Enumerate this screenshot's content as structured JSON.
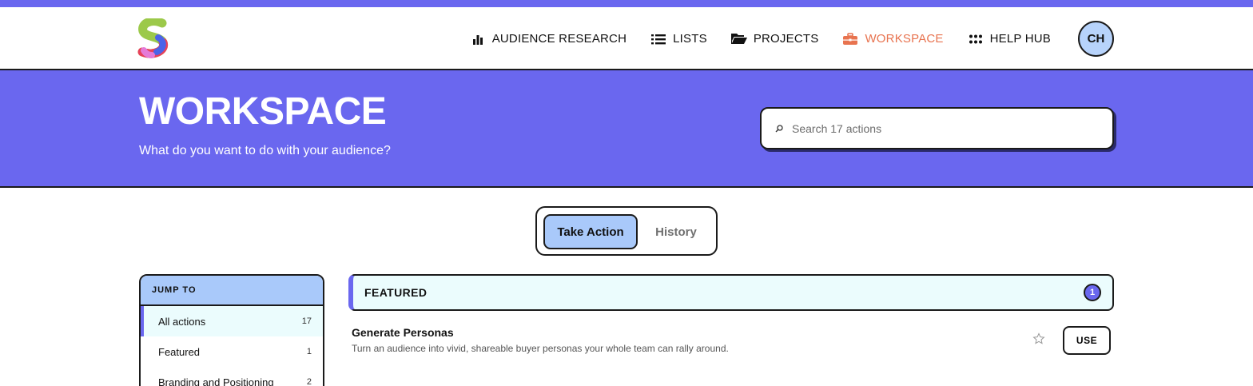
{
  "nav": {
    "items": [
      {
        "label": "AUDIENCE RESEARCH",
        "icon": "bar-chart-icon"
      },
      {
        "label": "LISTS",
        "icon": "list-icon"
      },
      {
        "label": "PROJECTS",
        "icon": "folder-icon"
      },
      {
        "label": "WORKSPACE",
        "icon": "briefcase-icon",
        "active": true
      },
      {
        "label": "HELP HUB",
        "icon": "grid-icon"
      }
    ],
    "avatar_initials": "CH"
  },
  "hero": {
    "title": "WORKSPACE",
    "subtitle": "What do you want to do with your audience?",
    "search_placeholder": "Search 17 actions"
  },
  "tabs": [
    {
      "label": "Take Action",
      "active": true
    },
    {
      "label": "History",
      "active": false
    }
  ],
  "sidebar": {
    "heading": "JUMP TO",
    "items": [
      {
        "label": "All actions",
        "count": "17",
        "active": true
      },
      {
        "label": "Featured",
        "count": "1"
      },
      {
        "label": "Branding and Positioning",
        "count": "2"
      }
    ]
  },
  "featured": {
    "title": "FEATURED",
    "count": "1"
  },
  "actions": [
    {
      "name": "Generate Personas",
      "description": "Turn an audience into vivid, shareable buyer personas your whole team can rally around.",
      "button": "USE"
    }
  ],
  "colors": {
    "brand": "#6a67ef",
    "active_nav": "#e8734f",
    "tab_active": "#a9c9fa",
    "row_active": "#ebfcfd"
  }
}
